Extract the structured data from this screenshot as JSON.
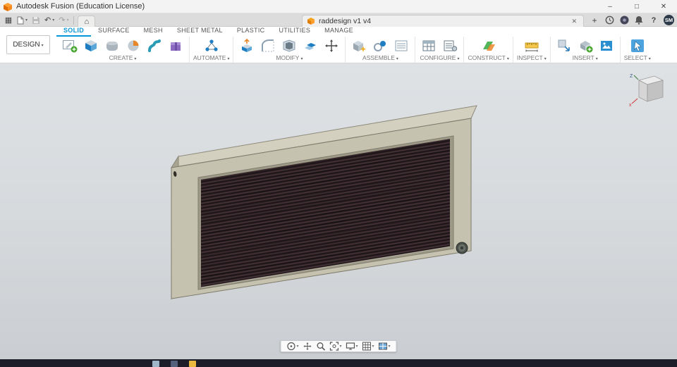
{
  "window": {
    "title": "Autodesk Fusion (Education License)",
    "minimize": "–",
    "maximize": "□",
    "close": "✕"
  },
  "glyphs": {
    "app_grid": "▦",
    "undo": "↶",
    "redo": "↷",
    "home": "⌂"
  },
  "tab_strip": {
    "document_tab": {
      "label": "raddesign v1 v4",
      "close": "✕"
    },
    "new_tab": "+",
    "help": "?",
    "avatar": "SM",
    "right_icons": [
      "job-status-clock",
      "notification-center",
      "notifications-bell",
      "help",
      "account-avatar"
    ]
  },
  "ribbon": {
    "design_menu": "DESIGN",
    "active_tab": "SOLID",
    "tabs": [
      "SOLID",
      "SURFACE",
      "MESH",
      "SHEET METAL",
      "PLASTIC",
      "UTILITIES",
      "MANAGE"
    ],
    "groups": [
      {
        "label": "CREATE",
        "icons": [
          "create-sketch",
          "extrude",
          "create-form",
          "revolve",
          "sweep",
          "coil"
        ]
      },
      {
        "label": "AUTOMATE",
        "icons": [
          "automate"
        ]
      },
      {
        "label": "MODIFY",
        "icons": [
          "press-pull",
          "fillet",
          "shell",
          "combine",
          "move-copy"
        ]
      },
      {
        "label": "ASSEMBLE",
        "icons": [
          "new-component",
          "joint",
          "rigid-group"
        ]
      },
      {
        "label": "CONFIGURE",
        "icons": [
          "configuration-table",
          "configure-features"
        ]
      },
      {
        "label": "CONSTRUCT",
        "icons": [
          "construction-plane"
        ]
      },
      {
        "label": "INSPECT",
        "icons": [
          "measure"
        ]
      },
      {
        "label": "INSERT",
        "icons": [
          "insert-derive",
          "insert-mesh",
          "canvas"
        ]
      },
      {
        "label": "SELECT",
        "icons": [
          "select"
        ]
      }
    ]
  },
  "canvas": {
    "viewcube": {
      "z_label": "Z",
      "x_label": "x"
    },
    "model": {
      "name": "radiator",
      "body_color": "#c6c2b0",
      "top_color": "#d4d0bf",
      "side_color": "#a8a492",
      "grille_color": "#2a1f22"
    },
    "nav_toolbar_icons": [
      "orbit",
      "pan",
      "zoom",
      "fit",
      "display-settings",
      "grid-and-snaps",
      "viewports"
    ]
  },
  "taskbar": {
    "items": [
      "pinned-app-1",
      "pinned-app-2",
      "pinned-app-3"
    ]
  },
  "colors": {
    "accent_blue": "#0696d7",
    "logo_orange": "#f6891f",
    "canvas_background": "#d5d9dc"
  }
}
